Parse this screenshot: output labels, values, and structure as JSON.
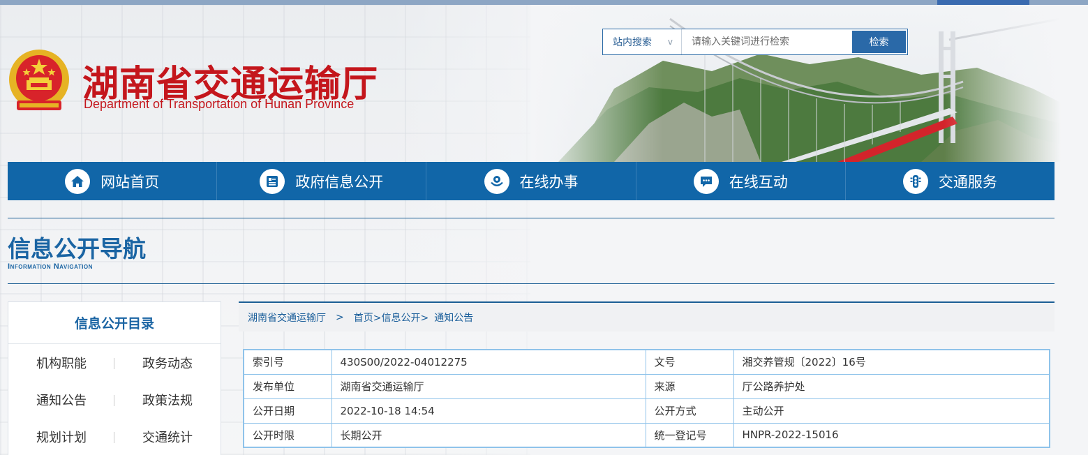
{
  "header": {
    "title": "湖南省交通运输厅",
    "subtitle": "Department of Transportation of Hunan Province"
  },
  "search": {
    "scope": "站内搜索",
    "scope_chevron": "v",
    "placeholder": "请输入关键词进行检索",
    "button": "检索"
  },
  "nav": {
    "items": [
      {
        "label": "网站首页",
        "icon": "home-icon"
      },
      {
        "label": "政府信息公开",
        "icon": "document-list-icon"
      },
      {
        "label": "在线办事",
        "icon": "service-hand-icon"
      },
      {
        "label": "在线互动",
        "icon": "chat-bubble-icon"
      },
      {
        "label": "交通服务",
        "icon": "traffic-light-icon"
      }
    ]
  },
  "section": {
    "title": "信息公开导航",
    "subtitle": "Information Navigation"
  },
  "catalog": {
    "title": "信息公开目录",
    "items": [
      "机构职能",
      "政务动态",
      "通知公告",
      "政策法规",
      "规划计划",
      "交通统计"
    ]
  },
  "breadcrumb": {
    "items": [
      "湖南省交通运输厅",
      "首页>信息公开>",
      "通知公告"
    ],
    "separator": ">"
  },
  "info_table": {
    "rows": [
      {
        "k1": "索引号",
        "v1": "430S00/2022-04012275",
        "k2": "文号",
        "v2": "湘交养管规〔2022〕16号"
      },
      {
        "k1": "发布单位",
        "v1": "湖南省交通运输厅",
        "k2": "来源",
        "v2": "厅公路养护处"
      },
      {
        "k1": "公开日期",
        "v1": "2022-10-18 14:54",
        "k2": "公开方式",
        "v2": "主动公开"
      },
      {
        "k1": "公开时限",
        "v1": "长期公开",
        "k2": "统一登记号",
        "v2": "HNPR-2022-15016"
      }
    ]
  },
  "colors": {
    "brand_red": "#c4161c",
    "nav_blue": "#1166a8",
    "table_border": "#8fc3ea"
  }
}
